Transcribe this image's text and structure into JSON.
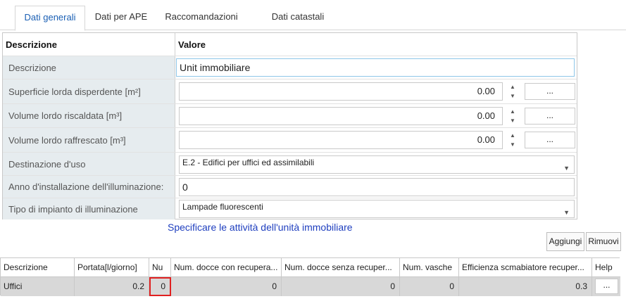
{
  "tabs": [
    {
      "label": "Dati generali",
      "active": true
    },
    {
      "label": "Dati per APE",
      "active": false
    },
    {
      "label": "Raccomandazioni",
      "active": false
    },
    {
      "label": "Dati catastali",
      "active": false
    }
  ],
  "props": {
    "header": {
      "col1": "Descrizione",
      "col2": "Valore"
    },
    "rows": [
      {
        "label": "Descrizione",
        "value": "Unit immobiliare"
      },
      {
        "label": "Superficie lorda disperdente [m²]",
        "value": "0.00"
      },
      {
        "label": "Volume lordo riscaldata [m³]",
        "value": "0.00"
      },
      {
        "label": "Volume lordo raffrescato [m³]",
        "value": "0.00"
      },
      {
        "label": "Destinazione d'uso",
        "value": "E.2 - Edifici per uffici ed assimilabili"
      },
      {
        "label": "Anno d'installazione dell'illuminazione:",
        "value": "0"
      },
      {
        "label": "Tipo di impianto di illuminazione",
        "value": "Lampade fluorescenti"
      }
    ],
    "ellipsis": "..."
  },
  "caption": "Specificare le attività dell'unità immobiliare",
  "buttons": {
    "add": "Aggiungi",
    "remove": "Rimuovi"
  },
  "grid": {
    "headers": [
      "Descrizione",
      "Portata[l/giorno]",
      "Nu",
      "Num. docce con recupera...",
      "Num. docce senza recuper...",
      "Num. vasche",
      "Efficienza scmabiatore recuper...",
      "Help"
    ],
    "row": [
      "Uffici",
      "0.2",
      "0",
      "0",
      "0",
      "0",
      "0.3"
    ],
    "help_label": "..."
  }
}
